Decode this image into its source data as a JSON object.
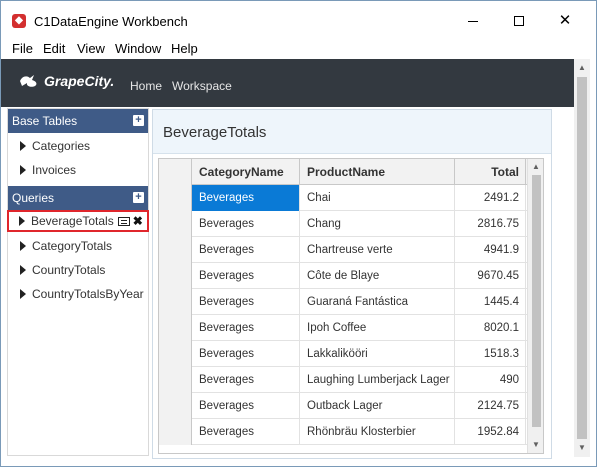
{
  "window": {
    "title": "C1DataEngine Workbench",
    "controls": [
      "minimize",
      "maximize",
      "close"
    ]
  },
  "menubar": {
    "items": [
      "File",
      "Edit",
      "View",
      "Window",
      "Help"
    ]
  },
  "brandbar": {
    "logo_text": "GrapeCity.",
    "nav": [
      "Home",
      "Workspace"
    ],
    "background": "#333940"
  },
  "sidebar": {
    "base_tables": {
      "label": "Base Tables",
      "items": [
        "Categories",
        "Invoices"
      ]
    },
    "queries": {
      "label": "Queries",
      "items": [
        "BeverageTotals",
        "CategoryTotals",
        "CountryTotals",
        "CountryTotalsByYear"
      ],
      "selected": "BeverageTotals"
    },
    "header_color": "#3f5b87"
  },
  "main": {
    "title": "BeverageTotals",
    "grid": {
      "columns": [
        "CategoryName",
        "ProductName",
        "Total"
      ],
      "rows": [
        [
          "Beverages",
          "Chai",
          "2491.2"
        ],
        [
          "Beverages",
          "Chang",
          "2816.75"
        ],
        [
          "Beverages",
          "Chartreuse verte",
          "4941.9"
        ],
        [
          "Beverages",
          "Côte de Blaye",
          "9670.45"
        ],
        [
          "Beverages",
          "Guaraná Fantástica",
          "1445.4"
        ],
        [
          "Beverages",
          "Ipoh Coffee",
          "8020.1"
        ],
        [
          "Beverages",
          "Lakkalikööri",
          "1518.3"
        ],
        [
          "Beverages",
          "Laughing Lumberjack Lager",
          "490"
        ],
        [
          "Beverages",
          "Outback Lager",
          "2124.75"
        ],
        [
          "Beverages",
          "Rhönbräu Klosterbier",
          "1952.84"
        ]
      ],
      "selected_cell": [
        0,
        0
      ],
      "selection_color": "#0a7ad6"
    }
  },
  "icons": {
    "app": "c1-app-icon",
    "add": "plus-icon",
    "view_data": "grid-icon",
    "delete": "close-icon",
    "expand": "triangle-right-icon"
  }
}
